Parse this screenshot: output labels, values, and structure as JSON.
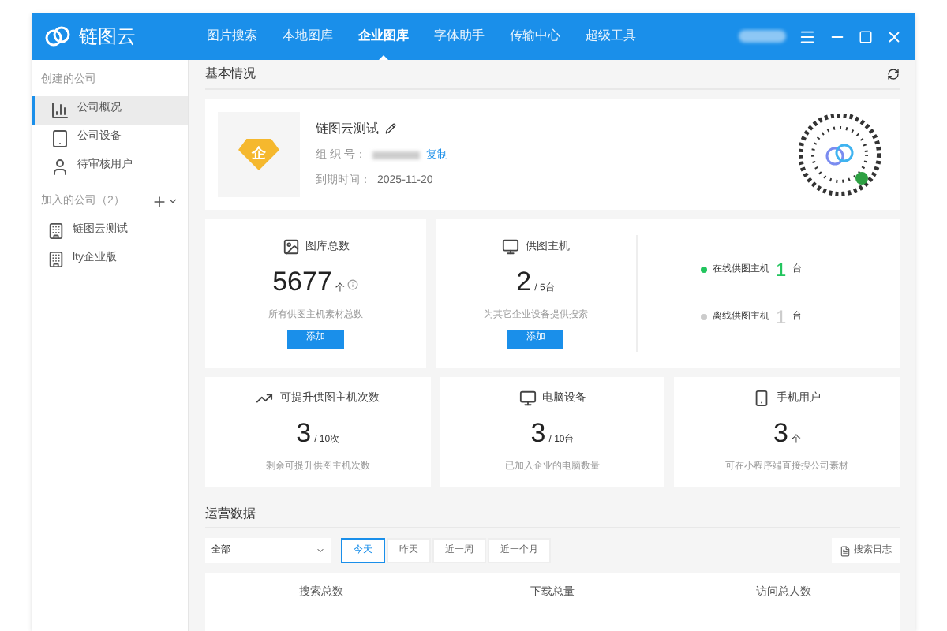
{
  "app": {
    "name": "链图云"
  },
  "nav": [
    {
      "label": "图片搜索",
      "selected": false
    },
    {
      "label": "本地图库",
      "selected": false
    },
    {
      "label": "企业图库",
      "selected": true
    },
    {
      "label": "字体助手",
      "selected": false
    },
    {
      "label": "传输中心",
      "selected": false
    },
    {
      "label": "超级工具",
      "selected": false
    }
  ],
  "sidebar": {
    "created_heading": "创建的公司",
    "created_items": [
      {
        "label": "公司概况",
        "selected": true
      },
      {
        "label": "公司设备",
        "selected": false
      },
      {
        "label": "待审核用户",
        "selected": false
      }
    ],
    "joined_heading": "加入的公司（2）",
    "joined_items": [
      {
        "label": "链图云测试",
        "selected": false
      },
      {
        "label": "lty企业版",
        "selected": false
      }
    ]
  },
  "basic": {
    "heading": "基本情况",
    "company_name": "链图云测试",
    "org_label": "组 织 号：",
    "copy_link": "复制",
    "expiry_label": "到期时间：",
    "expiry": "2025-11-20",
    "badge_char": "企"
  },
  "stats": [
    {
      "title": "图库总数",
      "value": "5677",
      "unit": "个",
      "info": true,
      "desc": "所有供图主机素材总数",
      "button": "添加"
    },
    {
      "title": "供图主机",
      "value": "2",
      "unit": "/ 5台",
      "info": false,
      "desc": "为其它企业设备提供搜索",
      "button": "添加"
    }
  ],
  "hosts": [
    {
      "label": "在线供图主机",
      "count": "1",
      "unit": "台",
      "color": "#22c55e"
    },
    {
      "label": "离线供图主机",
      "count": "1",
      "unit": "台",
      "color": "#cccccc"
    }
  ],
  "stats2": [
    {
      "title": "可提升供图主机次数",
      "value": "3",
      "unit": "/ 10次",
      "desc": "剩余可提升供图主机次数"
    },
    {
      "title": "电脑设备",
      "value": "3",
      "unit": "/ 10台",
      "desc": "已加入企业的电脑数量"
    },
    {
      "title": "手机用户",
      "value": "3",
      "unit": "个",
      "desc": "可在小程序端直接搜公司素材"
    }
  ],
  "ops": {
    "heading": "运营数据",
    "dropdown": "全部",
    "ranges": [
      {
        "label": "今天",
        "selected": true
      },
      {
        "label": "昨天",
        "selected": false
      },
      {
        "label": "近一周",
        "selected": false
      },
      {
        "label": "近一个月",
        "selected": false
      }
    ],
    "log_button": "搜索日志",
    "columns": [
      "搜索总数",
      "下载总量",
      "访问总人数"
    ]
  }
}
